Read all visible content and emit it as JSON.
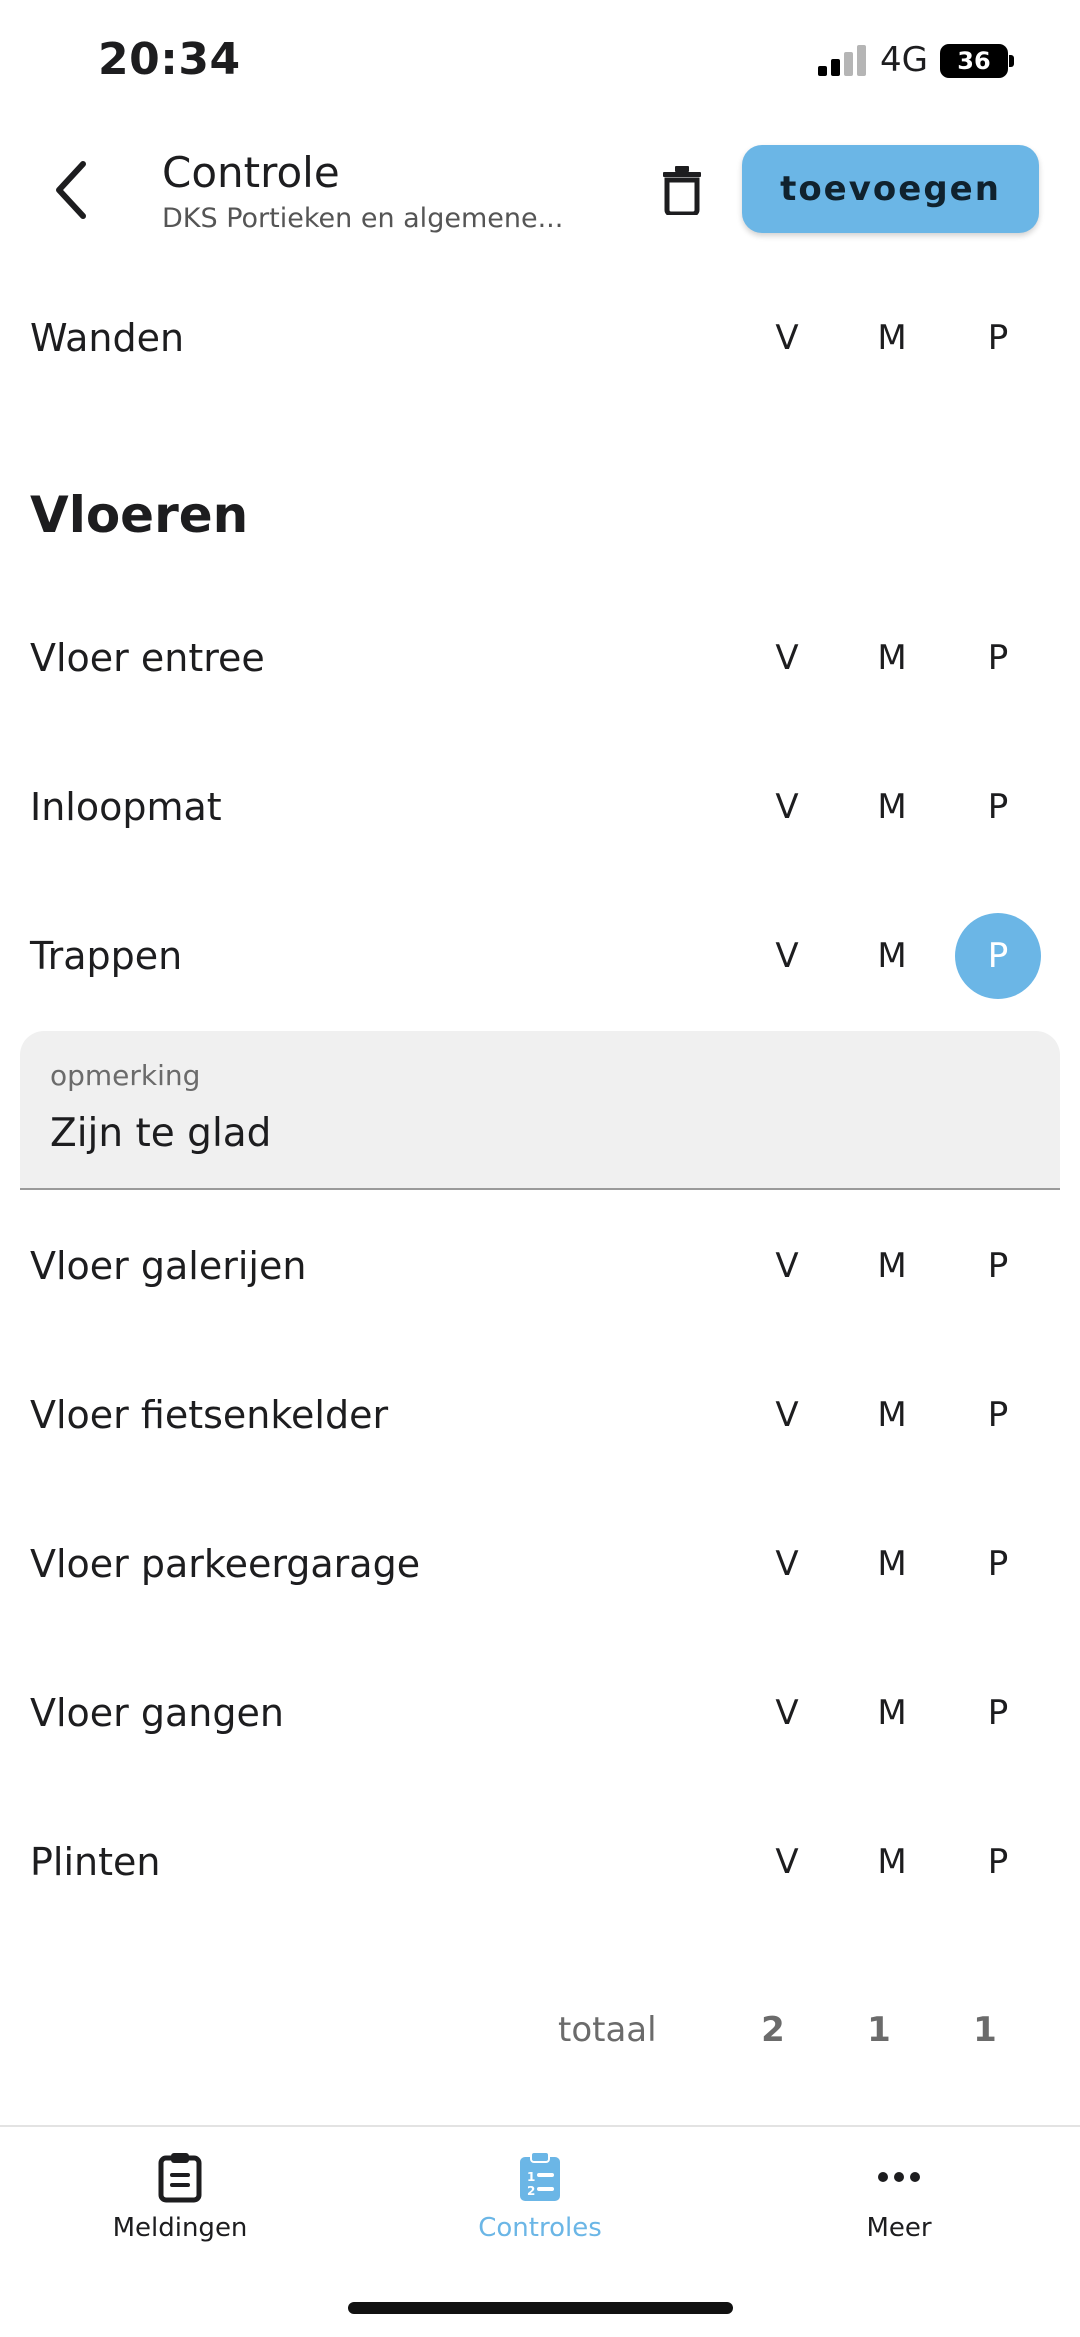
{
  "status_bar": {
    "time": "20:34",
    "network": "4G",
    "battery": "36"
  },
  "header": {
    "title": "Controle",
    "subtitle": "DKS Portieken en algemene...",
    "add_label": "toevoegen"
  },
  "options": {
    "v": "V",
    "m": "M",
    "p": "P"
  },
  "rows": {
    "wanden": {
      "label": "Wanden",
      "selected": null
    },
    "vloer_entree": {
      "label": "Vloer entree",
      "selected": null
    },
    "inloopmat": {
      "label": "Inloopmat",
      "selected": null
    },
    "trappen": {
      "label": "Trappen",
      "selected": "P"
    },
    "vloer_galerijen": {
      "label": "Vloer galerijen",
      "selected": null
    },
    "vloer_fietsenkelder": {
      "label": "Vloer fietsenkelder",
      "selected": null
    },
    "vloer_parkeergarage": {
      "label": "Vloer parkeergarage",
      "selected": null
    },
    "vloer_gangen": {
      "label": "Vloer gangen",
      "selected": null
    },
    "plinten": {
      "label": "Plinten",
      "selected": null
    }
  },
  "section": {
    "vloeren": "Vloeren"
  },
  "remark": {
    "label": "opmerking",
    "value": "Zijn te glad"
  },
  "totals": {
    "label": "totaal",
    "v": "2",
    "m": "1",
    "p": "1"
  },
  "tabs": {
    "meldingen": "Meldingen",
    "controles": "Controles",
    "meer": "Meer"
  },
  "colors": {
    "accent": "#6bb6e6",
    "text": "#1d1d1f",
    "muted": "#6b6b6b",
    "field_bg": "#f0f0f0"
  },
  "icons": {
    "back": "chevron-left-icon",
    "delete": "trash-icon",
    "meldingen": "clipboard-icon",
    "controles": "clipboard-list-icon",
    "meer": "more-dots-icon"
  }
}
